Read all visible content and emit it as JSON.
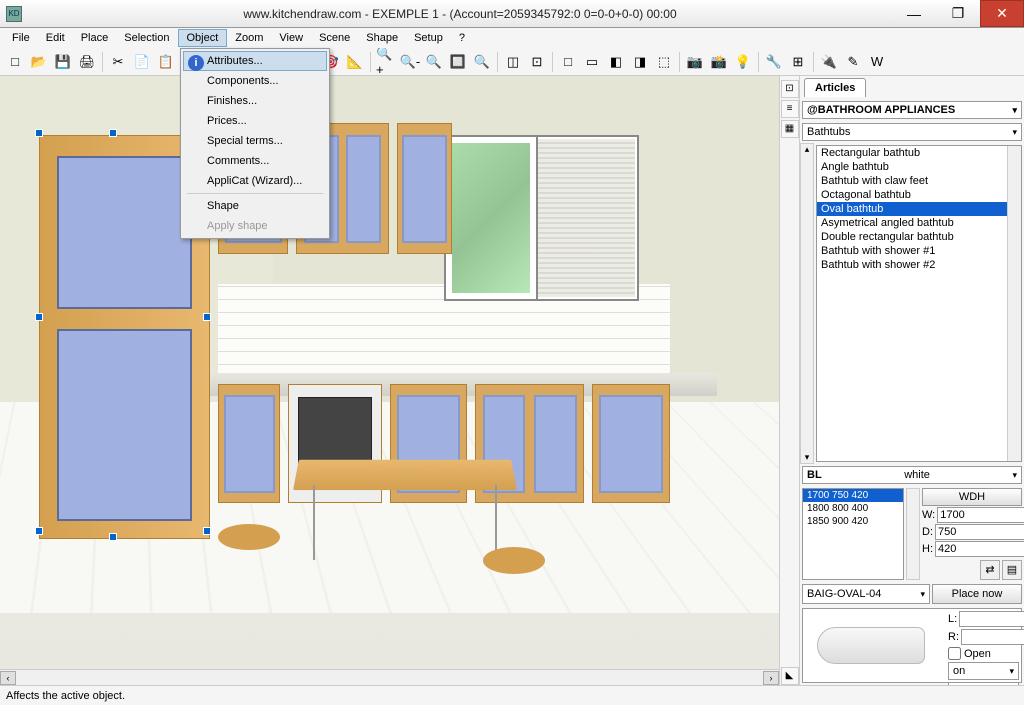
{
  "titlebar": {
    "icon": "KD",
    "text": "www.kitchendraw.com - EXEMPLE 1 - (Account=2059345792:0 0=0-0+0-0) 00:00"
  },
  "menubar": {
    "items": [
      "File",
      "Edit",
      "Place",
      "Selection",
      "Object",
      "Zoom",
      "View",
      "Scene",
      "Shape",
      "Setup",
      "?"
    ],
    "active_index": 4
  },
  "object_menu": {
    "items": [
      {
        "label": "Attributes...",
        "highlighted": true,
        "has_icon": true
      },
      {
        "label": "Components...",
        "highlighted": false
      },
      {
        "label": "Finishes...",
        "highlighted": false
      },
      {
        "label": "Prices...",
        "highlighted": false
      },
      {
        "label": "Special terms...",
        "highlighted": false
      },
      {
        "label": "Comments...",
        "highlighted": false
      },
      {
        "label": "AppliCat (Wizard)...",
        "highlighted": false
      },
      {
        "label": "Shape",
        "highlighted": false
      },
      {
        "label": "Apply shape",
        "highlighted": false,
        "disabled": true
      }
    ]
  },
  "toolbar": {
    "icons": [
      "□",
      "📂",
      "💾",
      "🖨",
      "✂",
      "📄",
      "📋",
      "↶",
      "↷",
      "+",
      "↔",
      "⊕",
      "🎯",
      "📐",
      "🔍+",
      "🔍-",
      "🔍",
      "🔲",
      "🔍",
      "◫",
      "⊡",
      "□",
      "▭",
      "◧",
      "◨",
      "⬚",
      "📷",
      "📸",
      "💡",
      "🔧",
      "⊞",
      "🔌",
      "✎",
      "W"
    ]
  },
  "articles_panel": {
    "tab": "Articles",
    "catalog": "@BATHROOM APPLIANCES",
    "category": "Bathtubs",
    "items": [
      "Rectangular bathtub",
      "Angle bathtub",
      "Bathtub with claw feet",
      "Octagonal bathtub",
      "Oval bathtub",
      "Asymetrical angled bathtub",
      "Double rectangular bathtub",
      "Bathtub with shower #1",
      "Bathtub with shower #2"
    ],
    "selected_index": 4,
    "color_code": "BL",
    "color_name": "white",
    "dimensions_list": [
      "1700  750  420",
      "1800  800  400",
      "1850  900  420"
    ],
    "dim_selected": 0,
    "wdh_label": "WDH",
    "W": "1700",
    "D": "750",
    "H": "420",
    "ref": "BAIG-OVAL-04",
    "place_btn": "Place now",
    "L": "",
    "R": "",
    "open_label": "Open",
    "on_value": "on"
  },
  "statusbar": {
    "text": "Affects the active object."
  }
}
